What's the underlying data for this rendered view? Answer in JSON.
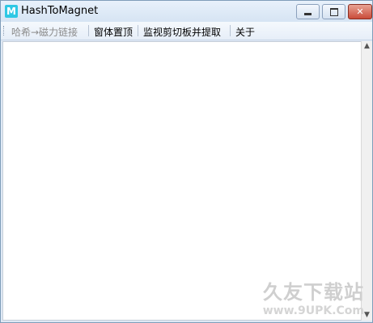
{
  "window": {
    "title": "HashToMagnet",
    "icon_letter": "M",
    "icon_name": "app-logo-icon",
    "accent_color": "#2ec8e4"
  },
  "controls": {
    "minimize_icon": "minimize-icon",
    "maximize_icon": "maximize-icon",
    "close_icon": "close-icon",
    "close_glyph": "✕"
  },
  "menu": {
    "items": [
      {
        "label": "哈希→磁力链接",
        "enabled": false
      },
      {
        "label": "窗体置顶",
        "enabled": true
      },
      {
        "label": "监视剪切板并提取",
        "enabled": true
      },
      {
        "label": "关于",
        "enabled": true
      }
    ]
  },
  "content": {
    "text": ""
  },
  "watermark": {
    "main": "久友下载站",
    "sub": "www.9UPK.Com"
  }
}
